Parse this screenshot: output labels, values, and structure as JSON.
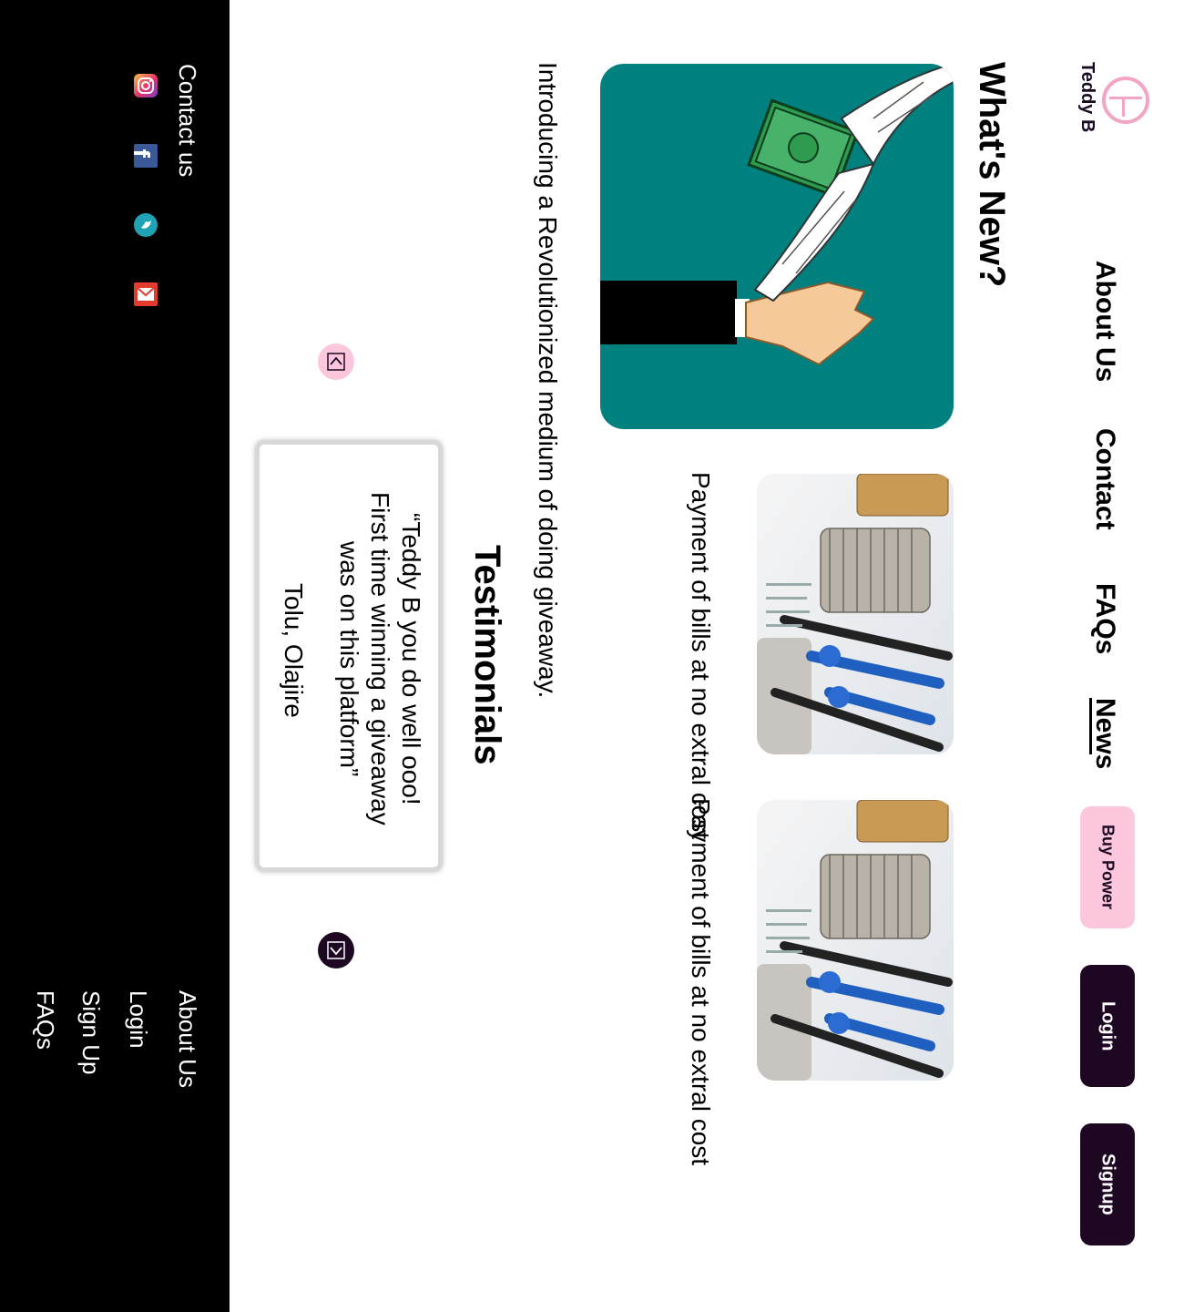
{
  "header": {
    "brand": "Teddy B",
    "nav": [
      "About Us",
      "Contact",
      "FAQs",
      "News"
    ],
    "active_nav": "News",
    "buttons": {
      "buy": "Buy Power",
      "login": "Login",
      "signup": "Signup"
    }
  },
  "main": {
    "heading": "What's New?",
    "intro": "Introducing a Revolutionized medium of doing giveaway.",
    "cards": [
      {
        "caption": "Payment of bills at no extral cost"
      },
      {
        "caption": "Payment of bills at no extral cost"
      }
    ]
  },
  "testimonials": {
    "heading": "Testimonials",
    "quote_lines": [
      "“Teddy B you do well ooo!",
      "First time winning a giveaway",
      "was on this platform”"
    ],
    "author": "Tolu, Olajire"
  },
  "footer": {
    "contact_label": "Contact us",
    "social_icons": [
      "instagram-icon",
      "facebook-icon",
      "twitter-icon",
      "gmail-icon"
    ],
    "links": [
      "About Us",
      "Login",
      "Sign Up",
      "FAQs"
    ]
  },
  "colors": {
    "brand_pink": "#f3a5c6",
    "button_pink": "#fcc7dd",
    "button_dark": "#1d0722",
    "hero_teal": "#00807f",
    "footer_bg": "#000000"
  }
}
